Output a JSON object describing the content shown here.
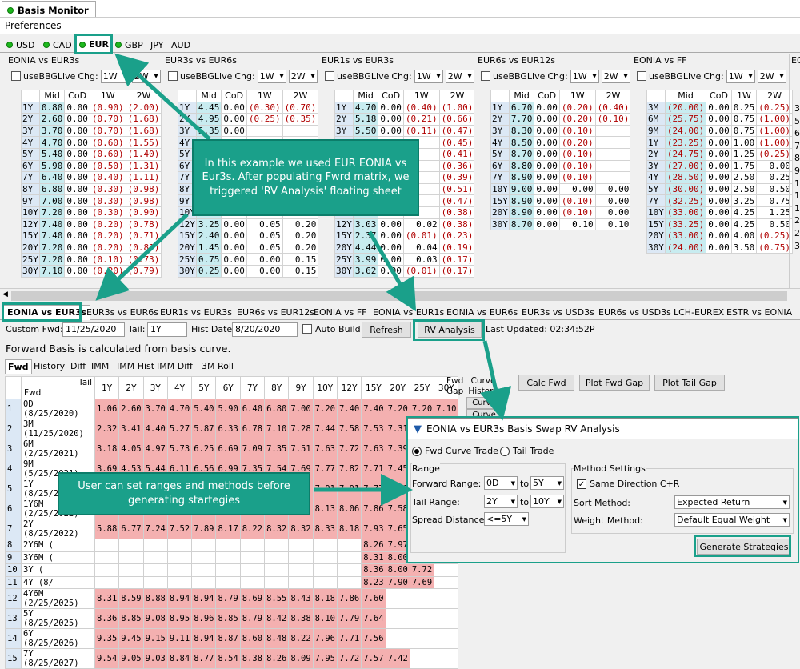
{
  "app": {
    "title": "Basis Monitor",
    "menu": "Preferences"
  },
  "currencies": [
    {
      "label": "USD",
      "dot": true
    },
    {
      "label": "CAD",
      "dot": true
    },
    {
      "label": "EUR",
      "dot": true,
      "selected": true
    },
    {
      "label": "GBP",
      "dot": true
    },
    {
      "label": "JPY",
      "dot": false
    },
    {
      "label": "AUD",
      "dot": false
    }
  ],
  "panel_controls": {
    "usebbg": "useBBGLive",
    "chg": "Chg:",
    "w1": "1W",
    "w2": "2W"
  },
  "grid_headers": [
    "Mid",
    "CoD",
    "1W",
    "2W"
  ],
  "panels": [
    {
      "title": "EONIA vs EUR3s",
      "rows": [
        [
          "1Y",
          "0.80",
          "0.00",
          "(0.90)",
          "(2.00)"
        ],
        [
          "2Y",
          "2.60",
          "0.00",
          "(0.70)",
          "(1.68)"
        ],
        [
          "3Y",
          "3.70",
          "0.00",
          "(0.70)",
          "(1.68)"
        ],
        [
          "4Y",
          "4.70",
          "0.00",
          "(0.60)",
          "(1.55)"
        ],
        [
          "5Y",
          "5.40",
          "0.00",
          "(0.60)",
          "(1.40)"
        ],
        [
          "6Y",
          "5.90",
          "0.00",
          "(0.50)",
          "(1.31)"
        ],
        [
          "7Y",
          "6.40",
          "0.00",
          "(0.40)",
          "(1.11)"
        ],
        [
          "8Y",
          "6.80",
          "0.00",
          "(0.30)",
          "(0.98)"
        ],
        [
          "9Y",
          "7.00",
          "0.00",
          "(0.30)",
          "(0.98)"
        ],
        [
          "10Y",
          "7.20",
          "0.00",
          "(0.30)",
          "(0.90)"
        ],
        [
          "12Y",
          "7.40",
          "0.00",
          "(0.20)",
          "(0.78)"
        ],
        [
          "15Y",
          "7.40",
          "0.00",
          "(0.20)",
          "(0.71)"
        ],
        [
          "20Y",
          "7.20",
          "0.00",
          "(0.20)",
          "(0.81)"
        ],
        [
          "25Y",
          "7.20",
          "0.00",
          "(0.10)",
          "(0.73)"
        ],
        [
          "30Y",
          "7.10",
          "0.00",
          "(0.20)",
          "(0.79)"
        ]
      ]
    },
    {
      "title": "EUR3s vs EUR6s",
      "rows": [
        [
          "1Y",
          "4.45",
          "0.00",
          "(0.30)",
          "(0.70)"
        ],
        [
          "2Y",
          "4.95",
          "0.00",
          "(0.25)",
          "(0.35)"
        ],
        [
          "3Y",
          "5.35",
          "0.00",
          "",
          ""
        ],
        [
          "4Y",
          "",
          "",
          "",
          ""
        ],
        [
          "5Y",
          "",
          "",
          "",
          ""
        ],
        [
          "6Y",
          "",
          "",
          "",
          ""
        ],
        [
          "7Y",
          "",
          "",
          "",
          ""
        ],
        [
          "8Y",
          "",
          "",
          "",
          ""
        ],
        [
          "9Y",
          "",
          "",
          "",
          ""
        ],
        [
          "10Y",
          "",
          "",
          "",
          ""
        ],
        [
          "12Y",
          "3.25",
          "0.00",
          "0.05",
          "0.20"
        ],
        [
          "15Y",
          "2.40",
          "0.00",
          "0.05",
          "0.20"
        ],
        [
          "20Y",
          "1.45",
          "0.00",
          "0.05",
          "0.20"
        ],
        [
          "25Y",
          "0.75",
          "0.00",
          "0.00",
          "0.15"
        ],
        [
          "30Y",
          "0.25",
          "0.00",
          "0.00",
          "0.15"
        ]
      ]
    },
    {
      "title": "EUR1s vs EUR3s",
      "rows": [
        [
          "1Y",
          "4.70",
          "0.00",
          "(0.40)",
          "(1.00)"
        ],
        [
          "2Y",
          "5.18",
          "0.00",
          "(0.21)",
          "(0.66)"
        ],
        [
          "3Y",
          "5.50",
          "0.00",
          "(0.11)",
          "(0.47)"
        ],
        [
          "4Y",
          "",
          "",
          "",
          "(0.45)"
        ],
        [
          "5Y",
          "",
          "",
          "",
          "(0.41)"
        ],
        [
          "6Y",
          "",
          "",
          "",
          "(0.36)"
        ],
        [
          "7Y",
          "",
          "",
          "",
          "(0.39)"
        ],
        [
          "8Y",
          "",
          "",
          "",
          "(0.51)"
        ],
        [
          "9Y",
          "",
          "",
          "",
          "(0.47)"
        ],
        [
          "10Y",
          "",
          "",
          "",
          "(0.38)"
        ],
        [
          "12Y",
          "3.03",
          "0.00",
          "0.02",
          "(0.38)"
        ],
        [
          "15Y",
          "2.37",
          "0.00",
          "(0.01)",
          "(0.23)"
        ],
        [
          "20Y",
          "4.44",
          "0.00",
          "0.04",
          "(0.19)"
        ],
        [
          "25Y",
          "3.99",
          "0.00",
          "0.03",
          "(0.17)"
        ],
        [
          "30Y",
          "3.62",
          "0.00",
          "(0.01)",
          "(0.17)"
        ]
      ]
    },
    {
      "title": "EUR6s vs EUR12s",
      "rows": [
        [
          "1Y",
          "6.70",
          "0.00",
          "(0.20)",
          "(0.40)"
        ],
        [
          "2Y",
          "7.70",
          "0.00",
          "(0.20)",
          "(0.10)"
        ],
        [
          "3Y",
          "8.30",
          "0.00",
          "(0.10)",
          ""
        ],
        [
          "4Y",
          "8.50",
          "0.00",
          "(0.20)",
          ""
        ],
        [
          "5Y",
          "8.70",
          "0.00",
          "(0.10)",
          ""
        ],
        [
          "6Y",
          "8.80",
          "0.00",
          "(0.10)",
          ""
        ],
        [
          "7Y",
          "8.90",
          "0.00",
          "(0.10)",
          ""
        ],
        [
          "10Y",
          "9.00",
          "0.00",
          "0.00",
          "0.00"
        ],
        [
          "15Y",
          "8.90",
          "0.00",
          "(0.10)",
          "0.00"
        ],
        [
          "20Y",
          "8.90",
          "0.00",
          "(0.10)",
          "0.00"
        ],
        [
          "30Y",
          "8.70",
          "0.00",
          "0.10",
          "0.10"
        ]
      ]
    },
    {
      "title": "EONIA vs FF",
      "rows": [
        [
          "3M",
          "(20.00)",
          "0.00",
          "0.25",
          "(0.25)"
        ],
        [
          "6M",
          "(25.75)",
          "0.00",
          "0.75",
          "(1.00)"
        ],
        [
          "9M",
          "(24.00)",
          "0.00",
          "0.75",
          "(1.00)"
        ],
        [
          "1Y",
          "(23.25)",
          "0.00",
          "1.00",
          "(1.00)"
        ],
        [
          "2Y",
          "(24.75)",
          "0.00",
          "1.25",
          "(0.25)"
        ],
        [
          "3Y",
          "(27.00)",
          "0.00",
          "1.75",
          "0.00"
        ],
        [
          "4Y",
          "(28.50)",
          "0.00",
          "2.50",
          "0.25"
        ],
        [
          "5Y",
          "(30.00)",
          "0.00",
          "2.50",
          "0.50"
        ],
        [
          "7Y",
          "(32.25)",
          "0.00",
          "3.25",
          "0.75"
        ],
        [
          "10Y",
          "(33.00)",
          "0.00",
          "4.25",
          "1.25"
        ],
        [
          "15Y",
          "(33.25)",
          "0.00",
          "4.25",
          "0.50"
        ],
        [
          "20Y",
          "(33.00)",
          "0.00",
          "4.00",
          "(0.25)"
        ],
        [
          "30Y",
          "(24.00)",
          "0.00",
          "3.50",
          "(0.75)"
        ]
      ]
    }
  ],
  "sixth_panel": {
    "title": "EONIA vs",
    "rows": [
      "3Y",
      "5",
      "6",
      "7",
      "8",
      "9",
      "1",
      "1",
      "1",
      "2",
      "2",
      "3"
    ]
  },
  "bottom_tabs": [
    "EONIA vs EUR3s",
    "EUR3s vs EUR6s",
    "EUR1s vs EUR3s",
    "EUR6s vs EUR12s",
    "EONIA vs FF",
    "EONIA vs EUR1s",
    "EONIA vs EUR6s",
    "EUR3s vs USD3s",
    "EUR6s vs USD3s",
    "LCH-EUREX",
    "ESTR vs EONIA"
  ],
  "controls": {
    "custom_fwd_label": "Custom Fwd:",
    "custom_fwd": "11/25/2020",
    "tail_label": "Tail:",
    "tail": "1Y",
    "hist_label": "Hist Date:",
    "hist": "8/20/2020",
    "auto_build": "Auto Build",
    "refresh": "Refresh",
    "rv": "RV Analysis",
    "last_updated": "Last Updated: 02:34:52P"
  },
  "info": "Forward Basis is calculated from basis curve.",
  "sub_tabs": [
    "Fwd",
    "History",
    "Diff",
    "IMM",
    "IMM Hist",
    "IMM Diff",
    "3M Roll"
  ],
  "fwd_grid": {
    "corner_top": "Tail",
    "corner_bottom": "Fwd",
    "cols": [
      "1Y",
      "2Y",
      "3Y",
      "4Y",
      "5Y",
      "6Y",
      "7Y",
      "8Y",
      "9Y",
      "10Y",
      "12Y",
      "15Y",
      "20Y",
      "25Y",
      "30Y"
    ],
    "rows": [
      [
        "1",
        "0D (8/25/2020)",
        [
          "1.06",
          "2.60",
          "3.70",
          "4.70",
          "5.40",
          "5.90",
          "6.40",
          "6.80",
          "7.00",
          "7.20",
          "7.40",
          "7.40",
          "7.20",
          "7.20",
          "7.10"
        ]
      ],
      [
        "2",
        "3M (11/25/2020)",
        [
          "2.32",
          "3.41",
          "4.40",
          "5.27",
          "5.87",
          "6.33",
          "6.78",
          "7.10",
          "7.28",
          "7.44",
          "7.58",
          "7.53",
          "7.31",
          "7.28",
          "7.17"
        ]
      ],
      [
        "3",
        "6M (2/25/2021)",
        [
          "3.18",
          "4.05",
          "4.97",
          "5.73",
          "6.25",
          "6.69",
          "7.09",
          "7.35",
          "7.51",
          "7.63",
          "7.72",
          "7.63",
          "7.39",
          "",
          " "
        ]
      ],
      [
        "4",
        "9M (5/25/2021)",
        [
          "3.69",
          "4.53",
          "5.44",
          "6.11",
          "6.56",
          "6.99",
          "7.35",
          "7.54",
          "7.69",
          "7.77",
          "7.82",
          "7.71",
          "7.45",
          "",
          ""
        ]
      ],
      [
        "5",
        "1Y (8/25/2021)",
        [
          "4.13",
          "5.01",
          "5.90",
          "6.47",
          "6.85",
          "7.27",
          "7.60",
          "7.72",
          "7.86",
          "7.91",
          "7.91",
          "7.77",
          "7.50",
          "",
          ""
        ]
      ],
      [
        "6",
        "1Y6M (2/25/2022)",
        [
          "4.90",
          "5.85",
          "6.57",
          "7.01",
          "7.38",
          "7.73",
          "7.93",
          "8.04",
          "8.11",
          "8.13",
          "8.06",
          "7.86",
          "7.58",
          "",
          ""
        ]
      ],
      [
        "7",
        "2Y (8/25/2022)",
        [
          "5.88",
          "6.77",
          "7.24",
          "7.52",
          "7.89",
          "8.17",
          "8.22",
          "8.32",
          "8.32",
          "8.33",
          "8.18",
          "7.93",
          "7.65",
          "",
          ""
        ]
      ],
      [
        "8",
        "2Y6M (",
        [
          "",
          "",
          "",
          "",
          "",
          "",
          "",
          "",
          "",
          "",
          "",
          "8.26",
          "7.97",
          "7.69",
          ""
        ]
      ],
      [
        "9",
        "3Y6M (",
        [
          "",
          "",
          "",
          "",
          "",
          "",
          "",
          "",
          "",
          "",
          "",
          "8.31",
          "8.00",
          "7.69",
          ""
        ]
      ],
      [
        "10",
        "3Y (",
        [
          "",
          "",
          "",
          "",
          "",
          "",
          "",
          "",
          "",
          "",
          "",
          "8.36",
          "8.00",
          "7.72",
          ""
        ]
      ],
      [
        "11",
        "4Y (8/",
        [
          "",
          "",
          "",
          "",
          "",
          "",
          "",
          "",
          "",
          "",
          "",
          "8.23",
          "7.90",
          "7.69",
          ""
        ]
      ],
      [
        "12",
        "4Y6M (2/25/2025)",
        [
          "8.31",
          "8.59",
          "8.88",
          "8.94",
          "8.94",
          "8.79",
          "8.69",
          "8.55",
          "8.43",
          "8.18",
          "7.86",
          "7.60",
          "",
          "",
          ""
        ]
      ],
      [
        "13",
        "5Y (8/25/2025)",
        [
          "8.36",
          "8.85",
          "9.08",
          "8.95",
          "8.96",
          "8.85",
          "8.79",
          "8.42",
          "8.38",
          "8.10",
          "7.79",
          "7.64",
          "",
          "",
          ""
        ]
      ],
      [
        "14",
        "6Y (8/25/2026)",
        [
          "9.35",
          "9.45",
          "9.15",
          "9.11",
          "8.94",
          "8.87",
          "8.60",
          "8.48",
          "8.22",
          "7.96",
          "7.71",
          "7.56",
          "",
          "",
          ""
        ]
      ],
      [
        "15",
        "7Y (8/25/2027)",
        [
          "9.54",
          "9.05",
          "9.03",
          "8.84",
          "8.77",
          "8.54",
          "8.38",
          "8.26",
          "8.09",
          "7.95",
          "7.72",
          "7.57",
          "7.42",
          "",
          ""
        ]
      ]
    ]
  },
  "fwd_side": {
    "gap": "Fwd Gap",
    "hist": "Curve History",
    "curve": "Curve"
  },
  "actions": {
    "calc": "Calc Fwd",
    "plot_gap": "Plot Fwd Gap",
    "plot_tail": "Plot Tail Gap"
  },
  "rv": {
    "title": "EONIA vs EUR3s Basis Swap RV Analysis",
    "fwd_trade": "Fwd Curve Trade",
    "tail_trade": "Tail Trade",
    "range": "Range",
    "fwd_range": "Forward Range:",
    "fwd_from": "0D",
    "to": "to",
    "fwd_to": "5Y",
    "tail_range": "Tail Range:",
    "tail_from": "2Y",
    "tail_to": "10Y",
    "spread": "Spread Distance:",
    "spread_val": "<=5Y",
    "method": "Method Settings",
    "same_dir": "Same Direction C+R",
    "sort": "Sort Method:",
    "sort_val": "Expected Return",
    "weight": "Weight Method:",
    "weight_val": "Default Equal Weight",
    "generate": "Generate Strategies"
  },
  "callouts": {
    "c1": "In this example we used EUR EONIA vs Eur3s. After populating Fwrd matrix, we triggered 'RV Analysis' floating sheet",
    "c2": "User can set ranges and methods before generating startegies"
  },
  "colors": {
    "accent": "#1aa08a",
    "neg": "#b00000",
    "cell_pink": "#f4b0b0"
  }
}
